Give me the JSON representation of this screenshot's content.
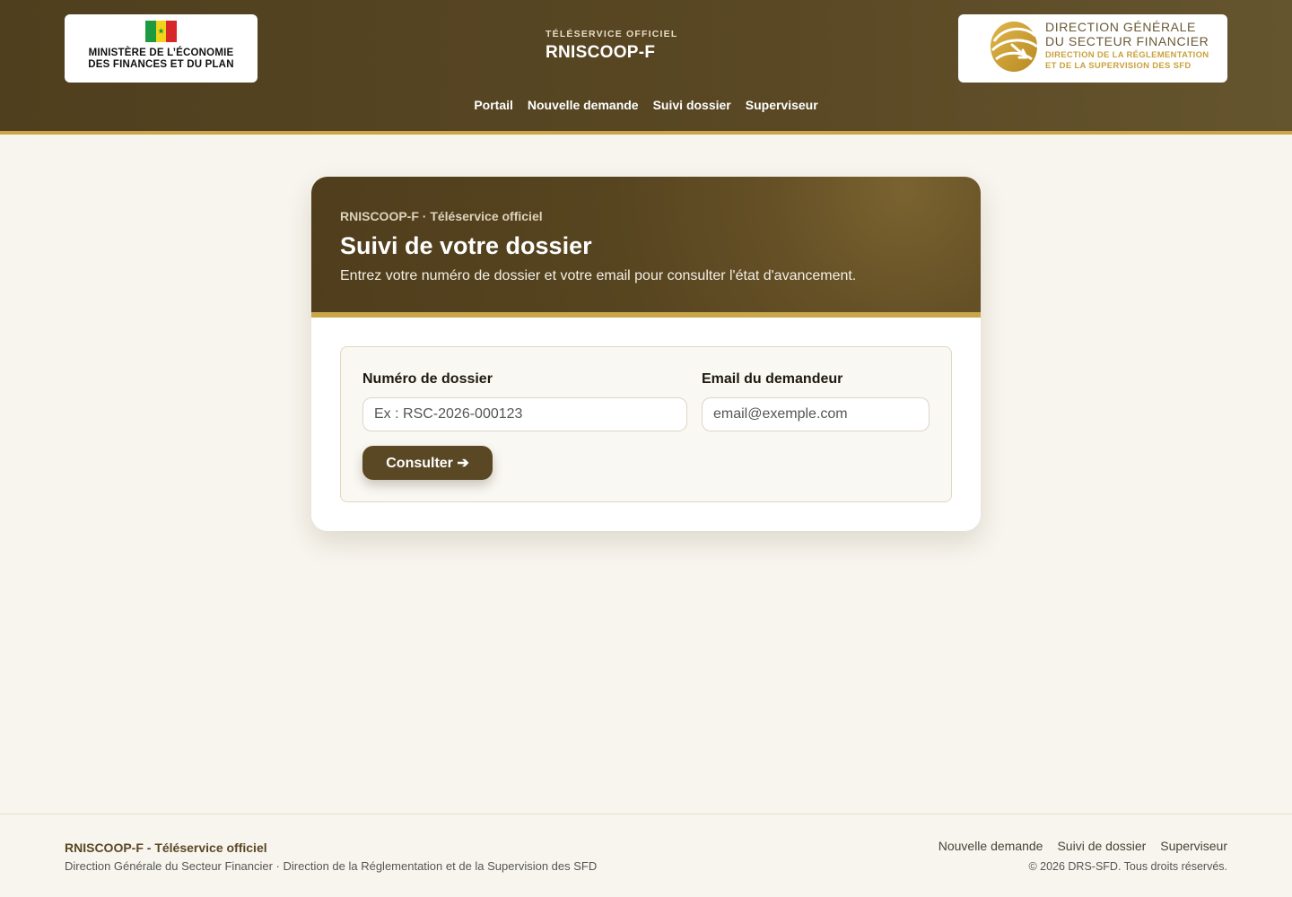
{
  "header": {
    "ministry_logo": {
      "line1": "MINISTÈRE DE L’ÉCONOMIE",
      "line2": "DES FINANCES ET DU PLAN"
    },
    "brand_kicker": "TÉLÉSERVICE OFFICIEL",
    "brand_name": "RNISCOOP-F",
    "dgsf_logo": {
      "line1": "DIRECTION GÉNÉRALE",
      "line2": "DU SECTEUR FINANCIER",
      "line3": "DIRECTION DE LA RÉGLEMENTATION",
      "line4": "ET DE LA SUPERVISION DES SFD"
    },
    "nav": [
      "Portail",
      "Nouvelle demande",
      "Suivi dossier",
      "Superviseur"
    ]
  },
  "card": {
    "kicker": "RNISCOOP-F · Téléservice officiel",
    "title": "Suivi de votre dossier",
    "subtitle": "Entrez votre numéro de dossier et votre email pour consulter l'état d'avancement.",
    "form": {
      "dossier_label": "Numéro de dossier",
      "dossier_placeholder": "Ex : RSC-2026-000123",
      "email_label": "Email du demandeur",
      "email_placeholder": "email@exemple.com",
      "submit_label": "Consulter ➔"
    }
  },
  "footer": {
    "title": "RNISCOOP-F - Téléservice officiel",
    "subtitle": "Direction Générale du Secteur Financier · Direction de la Réglementation et de la Supervision des SFD",
    "links": [
      "Nouvelle demande",
      "Suivi de dossier",
      "Superviseur"
    ],
    "copyright": "© 2026 DRS-SFD. Tous droits réservés."
  },
  "colors": {
    "header_brown": "#5a4824",
    "gold_accent": "#c9a64a",
    "page_background": "#f8f5ee"
  },
  "icons": [
    "senegal-flag-icon",
    "dgsf-logo-icon",
    "arrow-right-icon"
  ]
}
